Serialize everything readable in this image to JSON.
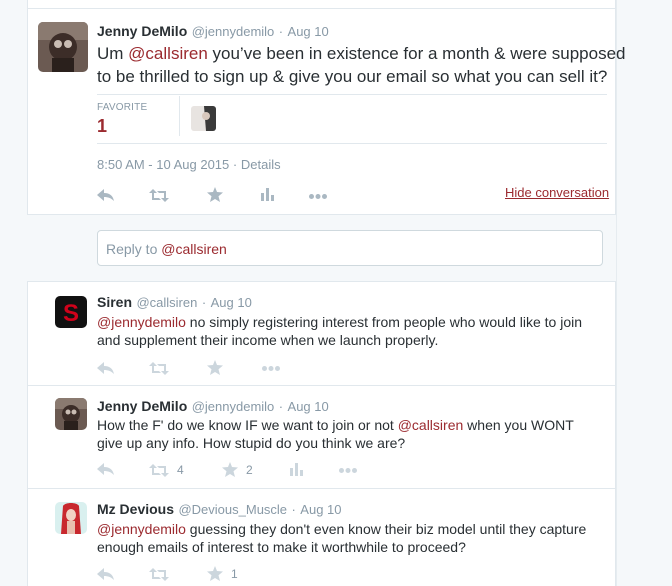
{
  "main_tweet": {
    "name": "Jenny DeMilo",
    "handle": "@jennydemilo",
    "sep": "·",
    "date": "Aug 10",
    "text_mention": "@callsiren",
    "text_prefix": "Um ",
    "text_line1_rest": " you’ve been in existence for a month & were supposed",
    "text_line2": "to be thrilled to sign up & give you our email so what you can sell it?",
    "favorite_label": "FAVORITE",
    "favorite_count": "1",
    "timestamp": "8:50 AM - 10 Aug 2015",
    "details_sep": "·",
    "details": "Details",
    "hide_conversation": "Hide conversation"
  },
  "reply_box": {
    "prefix": "Reply to ",
    "mention": "@callsiren"
  },
  "replies": [
    {
      "name": "Siren",
      "handle": "@callsiren",
      "sep": "·",
      "date": "Aug 10",
      "mention": "@jennydemilo",
      "line1_rest": " no simply registering interest from people who would like to join",
      "line2": "and supplement their income when we launch properly."
    },
    {
      "name": "Jenny DeMilo",
      "handle": "@jennydemilo",
      "sep": "·",
      "date": "Aug 10",
      "line1_prefix": "How the F' do we know IF we want to join or not ",
      "mention": "@callsiren",
      "line1_suffix": " when you WONT",
      "line2": "give up any info. How stupid do you think we are?",
      "retweet_count": "4",
      "favorite_count": "2"
    },
    {
      "name": "Mz Devious",
      "handle": "@Devious_Muscle",
      "sep": "·",
      "date": "Aug 10",
      "mention": "@jennydemilo",
      "line1_rest": " guessing they don't even know their biz model until they capture",
      "line2": "enough emails of interest to make it worthwhile to proceed?",
      "favorite_count": "1"
    }
  ],
  "colors": {
    "link": "#9b2a2f",
    "icon": "#aab8c2",
    "siren_red": "#d0021b"
  }
}
